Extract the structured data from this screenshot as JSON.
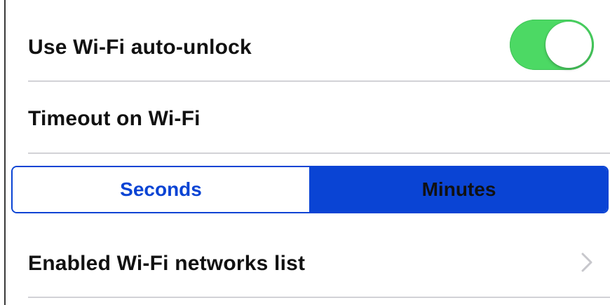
{
  "settings": {
    "wifi_auto_unlock": {
      "label": "Use Wi-Fi auto-unlock",
      "enabled": true
    },
    "timeout": {
      "label": "Timeout on Wi-Fi"
    },
    "unit_selector": {
      "options": [
        "Seconds",
        "Minutes"
      ],
      "selected": "Minutes"
    },
    "networks_list": {
      "label": "Enabled Wi-Fi networks list"
    }
  },
  "colors": {
    "toggle_on": "#4cd964",
    "segment_accent": "#0a44d4",
    "divider": "#d2d2d6"
  },
  "icons": {
    "disclosure": "chevron-right-icon"
  }
}
